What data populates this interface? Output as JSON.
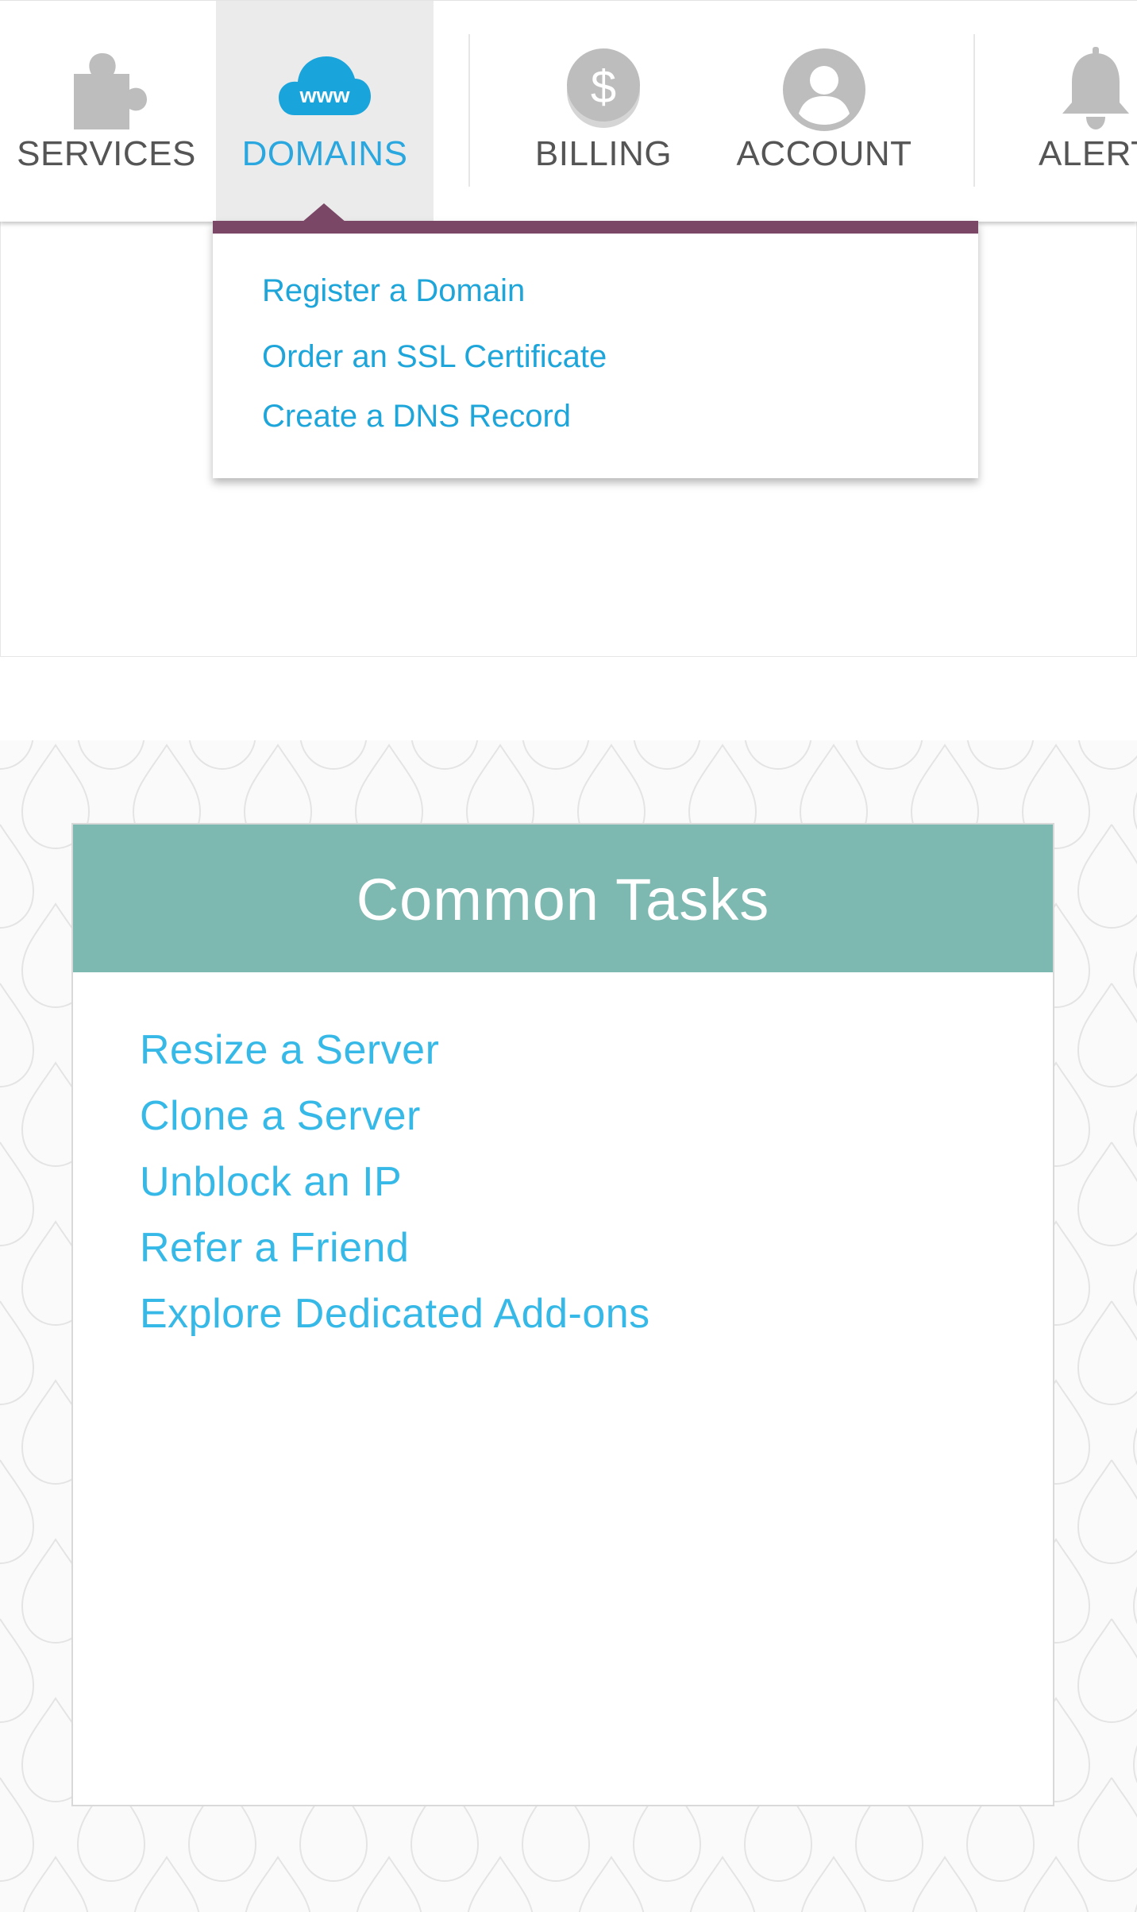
{
  "nav": {
    "items": [
      {
        "label": "SERVICES",
        "icon": "puzzle-icon"
      },
      {
        "label": "DOMAINS",
        "icon": "www-cloud-icon",
        "icon_text": "www",
        "active": true
      },
      {
        "label": "BILLING",
        "icon": "dollar-coin-icon",
        "icon_text": "$"
      },
      {
        "label": "ACCOUNT",
        "icon": "user-icon"
      },
      {
        "label": "ALERTS",
        "icon": "bell-icon"
      }
    ]
  },
  "dropdown": {
    "links": [
      "Register a Domain",
      "Order an SSL Certificate",
      "Create a DNS Record"
    ]
  },
  "common_tasks": {
    "title": "Common Tasks",
    "links": [
      "Resize a Server",
      "Clone a Server",
      "Unblock an IP",
      "Refer a Friend",
      "Explore Dedicated Add-ons"
    ]
  },
  "colors": {
    "active_blue": "#2aa7df",
    "dropdown_accent": "#7b4767",
    "tasks_header": "#7db9b1",
    "link_blue": "#37b9e8",
    "icon_grey": "#bdbdbd"
  }
}
